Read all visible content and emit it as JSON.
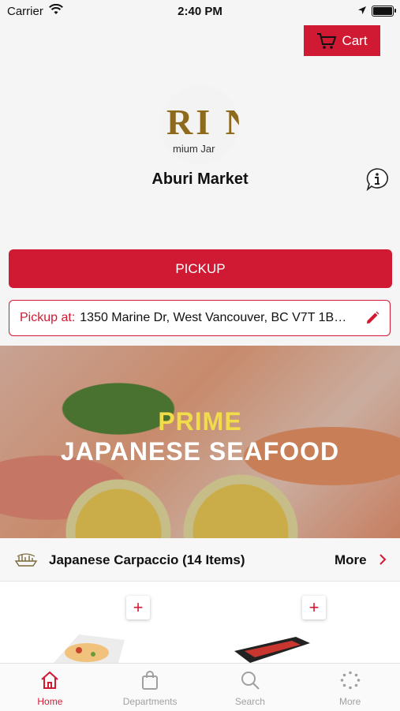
{
  "status_bar": {
    "carrier": "Carrier",
    "time": "2:40 PM"
  },
  "header": {
    "cart_label": "Cart"
  },
  "store": {
    "logo_text_large": "RI N",
    "logo_text_small": "mium Jar",
    "name": "Aburi Market"
  },
  "fulfillment": {
    "mode_label": "PICKUP",
    "pickup_label": "Pickup at:",
    "pickup_address": "1350 Marine Dr, West Vancouver, BC V7T 1B…"
  },
  "banner": {
    "line1": "PRIME",
    "line2": "JAPANESE SEAFOOD"
  },
  "category": {
    "title": "Japanese Carpaccio (14 Items)",
    "more_label": "More"
  },
  "products": [
    {
      "add_label": "+"
    },
    {
      "add_label": "+"
    }
  ],
  "tabbar": {
    "tabs": [
      {
        "label": "Home",
        "icon": "home-icon",
        "active": true
      },
      {
        "label": "Departments",
        "icon": "bag-icon",
        "active": false
      },
      {
        "label": "Search",
        "icon": "search-icon",
        "active": false
      },
      {
        "label": "More",
        "icon": "more-dots-icon",
        "active": false
      }
    ]
  },
  "colors": {
    "accent": "#d01a34",
    "banner_highlight": "#f1dc4a",
    "logo_gold": "#8e6a1c"
  }
}
